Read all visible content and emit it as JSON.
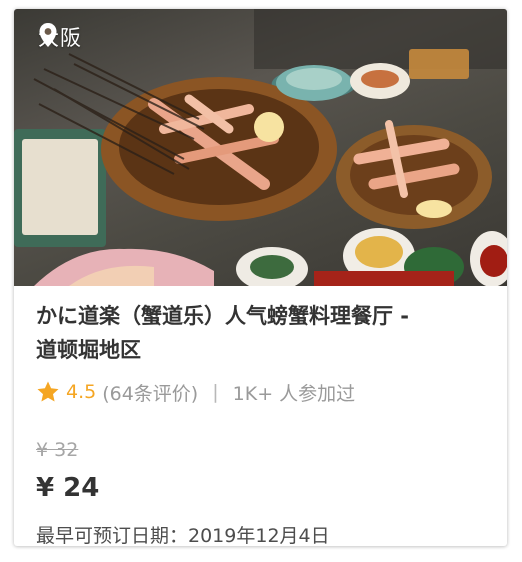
{
  "card": {
    "location": "大阪",
    "photo_alt": "crab dishes",
    "title": "かに道楽（蟹道乐）人气螃蟹料理餐厅 - 道顿堀地区",
    "rating": {
      "value": "4.5",
      "reviews": "(64条评价)",
      "separator": "|",
      "participants": "1K+ 人参加过"
    },
    "price": {
      "original": "¥ 32",
      "current": "¥ 24"
    },
    "booking_date": "最早可预订日期：2019年12月4日"
  },
  "colors": {
    "star": "#f5a623",
    "title": "#333333",
    "muted": "#9a9a9a"
  },
  "icons": {
    "location": "map-pin-icon",
    "rating": "star-icon"
  }
}
